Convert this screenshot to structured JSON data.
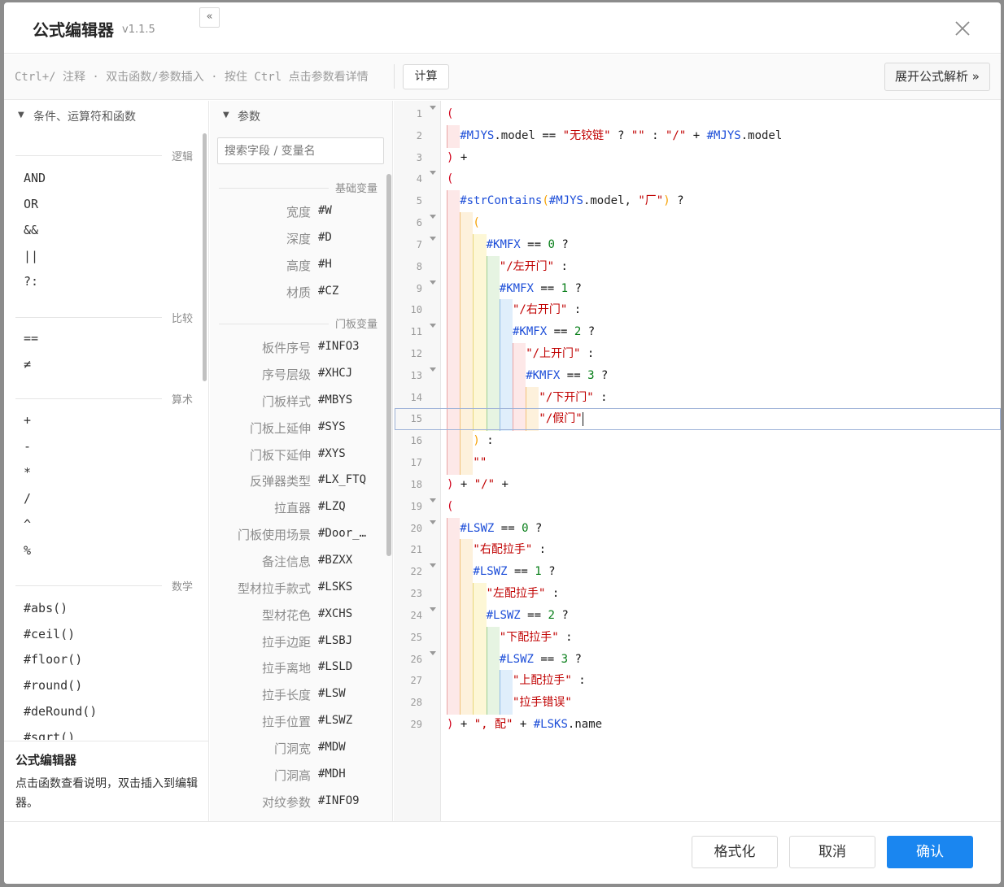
{
  "dialog": {
    "title": "公式编辑器",
    "version": "v1.1.5"
  },
  "toolbar": {
    "hint": "Ctrl+/ 注释 · 双击函数/参数插入 · 按住 Ctrl 点击参数看详情",
    "calc_label": "计算",
    "expand_label": "展开公式解析 »"
  },
  "left_panel": {
    "title": "条件、运算符和函数",
    "collapse_label": "«",
    "groups": [
      {
        "label": "逻辑",
        "items": [
          "AND",
          "OR",
          "&&",
          "||",
          "?:"
        ]
      },
      {
        "label": "比较",
        "items": [
          "==",
          "≠"
        ]
      },
      {
        "label": "算术",
        "items": [
          "+",
          "-",
          "*",
          "/",
          "^",
          "%"
        ]
      },
      {
        "label": "数学",
        "items": [
          "#abs()",
          "#ceil()",
          "#floor()",
          "#round()",
          "#deRound()",
          "#sqrt()"
        ]
      }
    ],
    "help_title": "公式编辑器",
    "help_text": "点击函数查看说明，双击插入到编辑器。"
  },
  "mid_panel": {
    "title": "参数",
    "search_placeholder": "搜索字段 / 变量名",
    "groups": [
      {
        "label": "基础变量",
        "params": [
          {
            "label": "宽度",
            "var": "#W"
          },
          {
            "label": "深度",
            "var": "#D"
          },
          {
            "label": "高度",
            "var": "#H"
          },
          {
            "label": "材质",
            "var": "#CZ"
          }
        ]
      },
      {
        "label": "门板变量",
        "params": [
          {
            "label": "板件序号",
            "var": "#INFO3"
          },
          {
            "label": "序号层级",
            "var": "#XHCJ"
          },
          {
            "label": "门板样式",
            "var": "#MBYS"
          },
          {
            "label": "门板上延伸",
            "var": "#SYS"
          },
          {
            "label": "门板下延伸",
            "var": "#XYS"
          },
          {
            "label": "反弹器类型",
            "var": "#LX_FTQ"
          },
          {
            "label": "拉直器",
            "var": "#LZQ"
          },
          {
            "label": "门板使用场景",
            "var": "#Door_…"
          },
          {
            "label": "备注信息",
            "var": "#BZXX"
          },
          {
            "label": "型材拉手款式",
            "var": "#LSKS"
          },
          {
            "label": "型材花色",
            "var": "#XCHS"
          },
          {
            "label": "拉手边距",
            "var": "#LSBJ"
          },
          {
            "label": "拉手离地",
            "var": "#LSLD"
          },
          {
            "label": "拉手长度",
            "var": "#LSW"
          },
          {
            "label": "拉手位置",
            "var": "#LSWZ"
          },
          {
            "label": "门洞宽",
            "var": "#MDW"
          },
          {
            "label": "门洞高",
            "var": "#MDH"
          },
          {
            "label": "对纹参数",
            "var": "#INFO9"
          }
        ]
      }
    ]
  },
  "editor": {
    "active_line": 15,
    "lines": [
      {
        "n": 1,
        "fold": true,
        "indent": 0,
        "tokens": [
          [
            "p",
            "("
          ]
        ]
      },
      {
        "n": 2,
        "fold": false,
        "indent": 1,
        "tokens": [
          [
            "v",
            "#MJYS"
          ],
          [
            "d",
            ".model "
          ],
          [
            "o",
            "== "
          ],
          [
            "s",
            "\"无铰链\""
          ],
          [
            "o",
            " ? "
          ],
          [
            "s",
            "\"\""
          ],
          [
            "o",
            " : "
          ],
          [
            "s",
            "\"/\""
          ],
          [
            "o",
            " + "
          ],
          [
            "v",
            "#MJYS"
          ],
          [
            "d",
            ".model"
          ]
        ]
      },
      {
        "n": 3,
        "fold": false,
        "indent": 0,
        "tokens": [
          [
            "p",
            ")"
          ],
          [
            "o",
            " +"
          ]
        ]
      },
      {
        "n": 4,
        "fold": true,
        "indent": 0,
        "tokens": [
          [
            "p",
            "("
          ]
        ]
      },
      {
        "n": 5,
        "fold": false,
        "indent": 1,
        "tokens": [
          [
            "f",
            "#strContains"
          ],
          [
            "p2",
            "("
          ],
          [
            "v",
            "#MJYS"
          ],
          [
            "d",
            ".model, "
          ],
          [
            "s",
            "\"厂\""
          ],
          [
            "p2",
            ")"
          ],
          [
            "o",
            " ?"
          ]
        ]
      },
      {
        "n": 6,
        "fold": true,
        "indent": 2,
        "tokens": [
          [
            "p2",
            "("
          ]
        ]
      },
      {
        "n": 7,
        "fold": true,
        "indent": 3,
        "tokens": [
          [
            "v",
            "#KMFX"
          ],
          [
            "o",
            " == "
          ],
          [
            "n",
            "0"
          ],
          [
            "o",
            " ?"
          ]
        ]
      },
      {
        "n": 8,
        "fold": false,
        "indent": 4,
        "tokens": [
          [
            "s",
            "\"/左开门\""
          ],
          [
            "o",
            " :"
          ]
        ]
      },
      {
        "n": 9,
        "fold": true,
        "indent": 4,
        "tokens": [
          [
            "v",
            "#KMFX"
          ],
          [
            "o",
            " == "
          ],
          [
            "n",
            "1"
          ],
          [
            "o",
            " ?"
          ]
        ]
      },
      {
        "n": 10,
        "fold": false,
        "indent": 5,
        "tokens": [
          [
            "s",
            "\"/右开门\""
          ],
          [
            "o",
            " :"
          ]
        ]
      },
      {
        "n": 11,
        "fold": true,
        "indent": 5,
        "tokens": [
          [
            "v",
            "#KMFX"
          ],
          [
            "o",
            " == "
          ],
          [
            "n",
            "2"
          ],
          [
            "o",
            " ?"
          ]
        ]
      },
      {
        "n": 12,
        "fold": false,
        "indent": 6,
        "tokens": [
          [
            "s",
            "\"/上开门\""
          ],
          [
            "o",
            " :"
          ]
        ]
      },
      {
        "n": 13,
        "fold": true,
        "indent": 6,
        "tokens": [
          [
            "v",
            "#KMFX"
          ],
          [
            "o",
            " == "
          ],
          [
            "n",
            "3"
          ],
          [
            "o",
            " ?"
          ]
        ]
      },
      {
        "n": 14,
        "fold": false,
        "indent": 7,
        "tokens": [
          [
            "s",
            "\"/下开门\""
          ],
          [
            "o",
            " :"
          ]
        ]
      },
      {
        "n": 15,
        "fold": false,
        "indent": 7,
        "tokens": [
          [
            "s",
            "\"/假门\""
          ]
        ]
      },
      {
        "n": 16,
        "fold": false,
        "indent": 2,
        "tokens": [
          [
            "p2",
            ")"
          ],
          [
            "o",
            " :"
          ]
        ]
      },
      {
        "n": 17,
        "fold": false,
        "indent": 2,
        "tokens": [
          [
            "s",
            "\"\""
          ]
        ]
      },
      {
        "n": 18,
        "fold": false,
        "indent": 0,
        "tokens": [
          [
            "p",
            ")"
          ],
          [
            "o",
            " + "
          ],
          [
            "s",
            "\"/\""
          ],
          [
            "o",
            " +"
          ]
        ]
      },
      {
        "n": 19,
        "fold": true,
        "indent": 0,
        "tokens": [
          [
            "p",
            "("
          ]
        ]
      },
      {
        "n": 20,
        "fold": true,
        "indent": 1,
        "tokens": [
          [
            "v",
            "#LSWZ"
          ],
          [
            "o",
            " == "
          ],
          [
            "n",
            "0"
          ],
          [
            "o",
            " ?"
          ]
        ]
      },
      {
        "n": 21,
        "fold": false,
        "indent": 2,
        "tokens": [
          [
            "s",
            "\"右配拉手\""
          ],
          [
            "o",
            " :"
          ]
        ]
      },
      {
        "n": 22,
        "fold": true,
        "indent": 2,
        "tokens": [
          [
            "v",
            "#LSWZ"
          ],
          [
            "o",
            " == "
          ],
          [
            "n",
            "1"
          ],
          [
            "o",
            " ?"
          ]
        ]
      },
      {
        "n": 23,
        "fold": false,
        "indent": 3,
        "tokens": [
          [
            "s",
            "\"左配拉手\""
          ],
          [
            "o",
            " :"
          ]
        ]
      },
      {
        "n": 24,
        "fold": true,
        "indent": 3,
        "tokens": [
          [
            "v",
            "#LSWZ"
          ],
          [
            "o",
            " == "
          ],
          [
            "n",
            "2"
          ],
          [
            "o",
            " ?"
          ]
        ]
      },
      {
        "n": 25,
        "fold": false,
        "indent": 4,
        "tokens": [
          [
            "s",
            "\"下配拉手\""
          ],
          [
            "o",
            " :"
          ]
        ]
      },
      {
        "n": 26,
        "fold": true,
        "indent": 4,
        "tokens": [
          [
            "v",
            "#LSWZ"
          ],
          [
            "o",
            " == "
          ],
          [
            "n",
            "3"
          ],
          [
            "o",
            " ?"
          ]
        ]
      },
      {
        "n": 27,
        "fold": false,
        "indent": 5,
        "tokens": [
          [
            "s",
            "\"上配拉手\""
          ],
          [
            "o",
            " :"
          ]
        ]
      },
      {
        "n": 28,
        "fold": false,
        "indent": 5,
        "tokens": [
          [
            "s",
            "\"拉手错误\""
          ]
        ]
      },
      {
        "n": 29,
        "fold": false,
        "indent": 0,
        "tokens": [
          [
            "p",
            ")"
          ],
          [
            "o",
            " + "
          ],
          [
            "s",
            "\", 配\""
          ],
          [
            "o",
            " + "
          ],
          [
            "v",
            "#LSKS"
          ],
          [
            "d",
            ".name"
          ]
        ]
      }
    ],
    "guide_colors": [
      "#fde8e8",
      "#fdf1dc",
      "#fdf7d6",
      "#e6f4e2",
      "#e0eefb",
      "#fde8e8",
      "#fdf1dc"
    ]
  },
  "footer": {
    "format_label": "格式化",
    "cancel_label": "取消",
    "ok_label": "确认"
  }
}
